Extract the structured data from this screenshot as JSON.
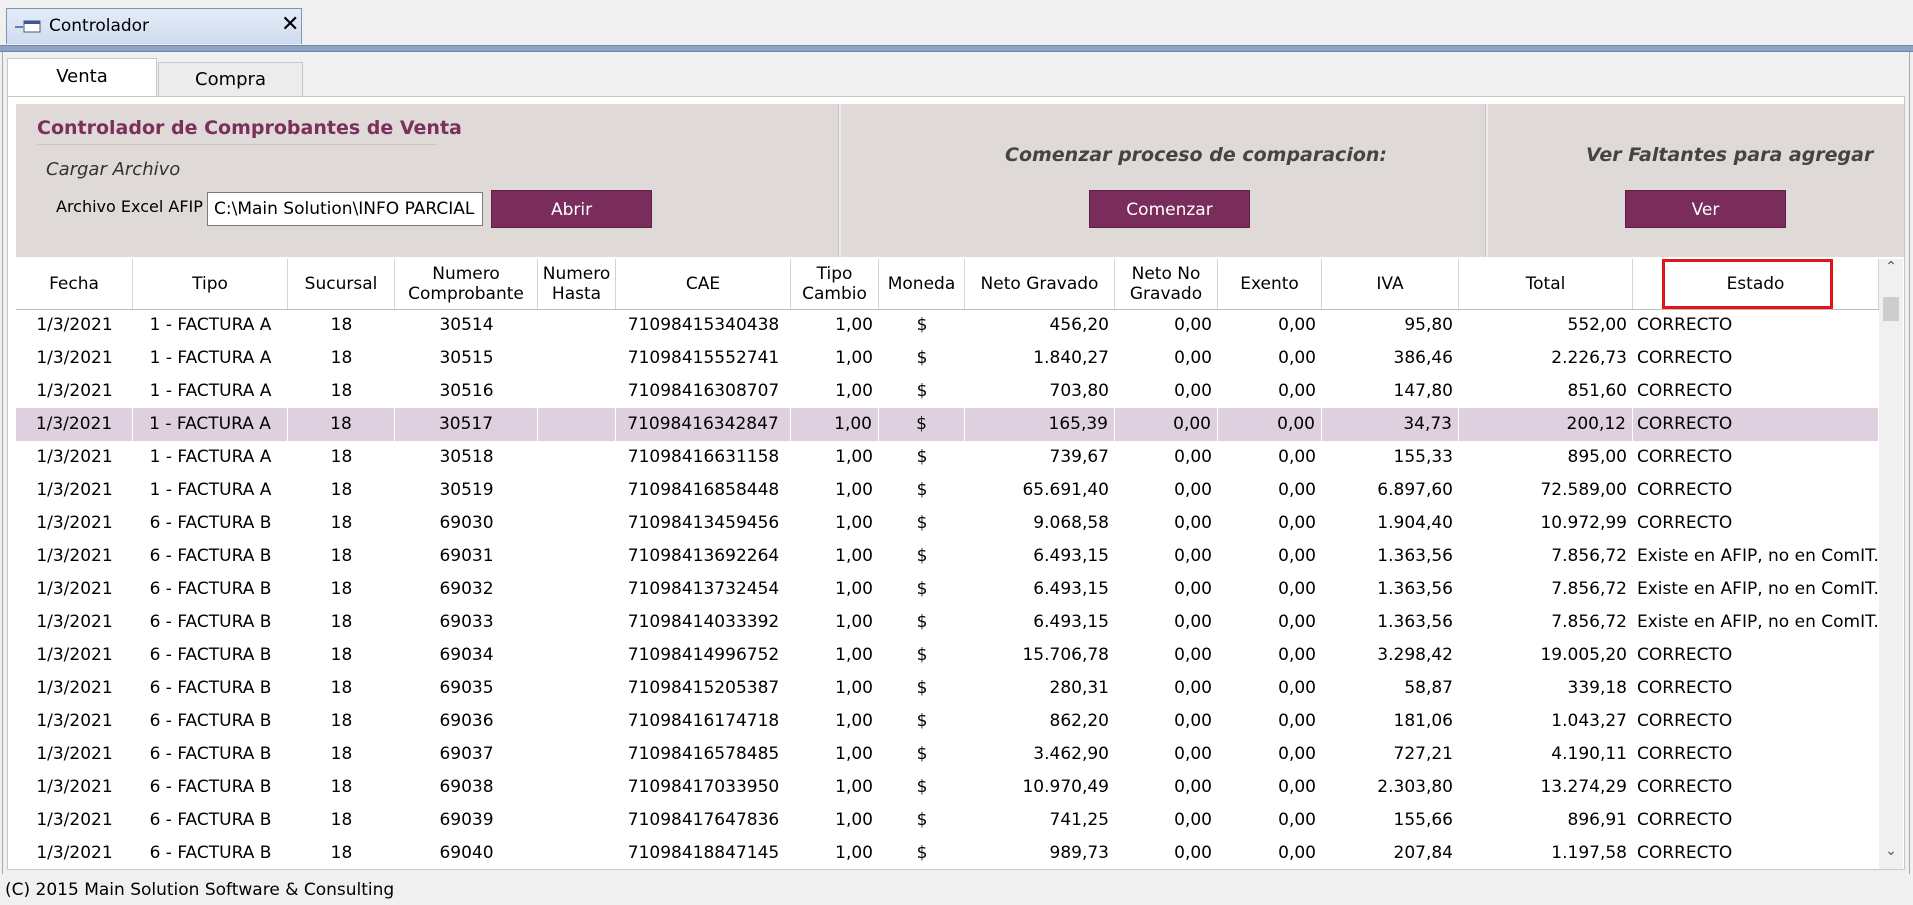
{
  "window": {
    "tab_title": "Controlador",
    "close_glyph": "✕"
  },
  "subtabs": [
    {
      "label": "Venta",
      "active": true
    },
    {
      "label": "Compra",
      "active": false
    }
  ],
  "load_section": {
    "title": "Controlador de Comprobantes de Venta",
    "cargar_label": "Cargar Archivo",
    "archivo_label": "Archivo Excel AFIP :",
    "archivo_value": "C:\\Main Solution\\INFO PARCIAL",
    "abrir_label": "Abrir"
  },
  "compare_section": {
    "heading": "Comenzar proceso de comparacion:",
    "button_label": "Comenzar"
  },
  "missing_section": {
    "heading": "Ver Faltantes para agregar",
    "button_label": "Ver"
  },
  "table": {
    "headers": [
      "Fecha",
      "Tipo",
      "Sucursal",
      "Numero Comprobante",
      "Numero Hasta",
      "CAE",
      "Tipo Cambio",
      "Moneda",
      "Neto Gravado",
      "Neto No Gravado",
      "Exento",
      "IVA",
      "Total",
      "Estado"
    ],
    "highlighted_column": "Estado",
    "selected_row_index": 3,
    "rows": [
      [
        "1/3/2021",
        "1 - FACTURA A",
        "18",
        "30514",
        "",
        "71098415340438",
        "1,00",
        "$",
        "456,20",
        "0,00",
        "0,00",
        "95,80",
        "552,00",
        "CORRECTO"
      ],
      [
        "1/3/2021",
        "1 - FACTURA A",
        "18",
        "30515",
        "",
        "71098415552741",
        "1,00",
        "$",
        "1.840,27",
        "0,00",
        "0,00",
        "386,46",
        "2.226,73",
        "CORRECTO"
      ],
      [
        "1/3/2021",
        "1 - FACTURA A",
        "18",
        "30516",
        "",
        "71098416308707",
        "1,00",
        "$",
        "703,80",
        "0,00",
        "0,00",
        "147,80",
        "851,60",
        "CORRECTO"
      ],
      [
        "1/3/2021",
        "1 - FACTURA A",
        "18",
        "30517",
        "",
        "71098416342847",
        "1,00",
        "$",
        "165,39",
        "0,00",
        "0,00",
        "34,73",
        "200,12",
        "CORRECTO"
      ],
      [
        "1/3/2021",
        "1 - FACTURA A",
        "18",
        "30518",
        "",
        "71098416631158",
        "1,00",
        "$",
        "739,67",
        "0,00",
        "0,00",
        "155,33",
        "895,00",
        "CORRECTO"
      ],
      [
        "1/3/2021",
        "1 - FACTURA A",
        "18",
        "30519",
        "",
        "71098416858448",
        "1,00",
        "$",
        "65.691,40",
        "0,00",
        "0,00",
        "6.897,60",
        "72.589,00",
        "CORRECTO"
      ],
      [
        "1/3/2021",
        "6 - FACTURA B",
        "18",
        "69030",
        "",
        "71098413459456",
        "1,00",
        "$",
        "9.068,58",
        "0,00",
        "0,00",
        "1.904,40",
        "10.972,99",
        "CORRECTO"
      ],
      [
        "1/3/2021",
        "6 - FACTURA B",
        "18",
        "69031",
        "",
        "71098413692264",
        "1,00",
        "$",
        "6.493,15",
        "0,00",
        "0,00",
        "1.363,56",
        "7.856,72",
        "Existe en AFIP, no en ComIT."
      ],
      [
        "1/3/2021",
        "6 - FACTURA B",
        "18",
        "69032",
        "",
        "71098413732454",
        "1,00",
        "$",
        "6.493,15",
        "0,00",
        "0,00",
        "1.363,56",
        "7.856,72",
        "Existe en AFIP, no en ComIT."
      ],
      [
        "1/3/2021",
        "6 - FACTURA B",
        "18",
        "69033",
        "",
        "71098414033392",
        "1,00",
        "$",
        "6.493,15",
        "0,00",
        "0,00",
        "1.363,56",
        "7.856,72",
        "Existe en AFIP, no en ComIT."
      ],
      [
        "1/3/2021",
        "6 - FACTURA B",
        "18",
        "69034",
        "",
        "71098414996752",
        "1,00",
        "$",
        "15.706,78",
        "0,00",
        "0,00",
        "3.298,42",
        "19.005,20",
        "CORRECTO"
      ],
      [
        "1/3/2021",
        "6 - FACTURA B",
        "18",
        "69035",
        "",
        "71098415205387",
        "1,00",
        "$",
        "280,31",
        "0,00",
        "0,00",
        "58,87",
        "339,18",
        "CORRECTO"
      ],
      [
        "1/3/2021",
        "6 - FACTURA B",
        "18",
        "69036",
        "",
        "71098416174718",
        "1,00",
        "$",
        "862,20",
        "0,00",
        "0,00",
        "181,06",
        "1.043,27",
        "CORRECTO"
      ],
      [
        "1/3/2021",
        "6 - FACTURA B",
        "18",
        "69037",
        "",
        "71098416578485",
        "1,00",
        "$",
        "3.462,90",
        "0,00",
        "0,00",
        "727,21",
        "4.190,11",
        "CORRECTO"
      ],
      [
        "1/3/2021",
        "6 - FACTURA B",
        "18",
        "69038",
        "",
        "71098417033950",
        "1,00",
        "$",
        "10.970,49",
        "0,00",
        "0,00",
        "2.303,80",
        "13.274,29",
        "CORRECTO"
      ],
      [
        "1/3/2021",
        "6 - FACTURA B",
        "18",
        "69039",
        "",
        "71098417647836",
        "1,00",
        "$",
        "741,25",
        "0,00",
        "0,00",
        "155,66",
        "896,91",
        "CORRECTO"
      ],
      [
        "1/3/2021",
        "6 - FACTURA B",
        "18",
        "69040",
        "",
        "71098418847145",
        "1,00",
        "$",
        "989,73",
        "0,00",
        "0,00",
        "207,84",
        "1.197,58",
        "CORRECTO"
      ]
    ]
  },
  "scrollbar": {
    "up": "⌃",
    "down": "⌄"
  },
  "footer": {
    "text": "(C) 2015 Main Solution Software & Consulting"
  },
  "colors": {
    "accent": "#7a2c5a",
    "selected_row": "#dfd0e0",
    "highlight_border": "#e2141b"
  }
}
